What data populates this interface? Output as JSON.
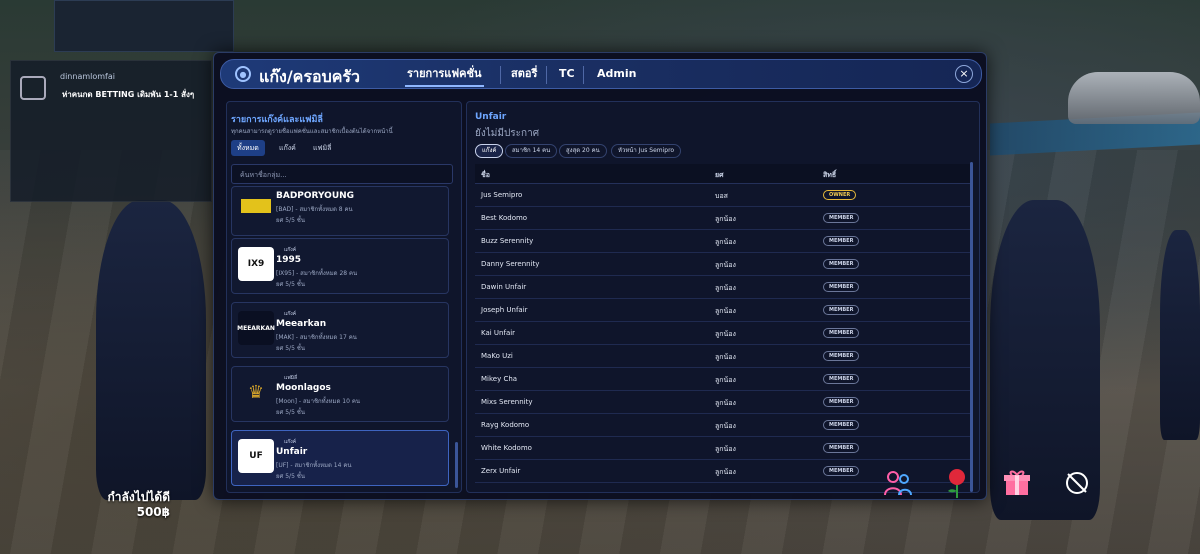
{
  "stream": {
    "username": "dinnamlomfai",
    "message": "ห่าคนกด BETTING เดิมพัน 1-1 สั่งๆ"
  },
  "hud": {
    "money_label": "กำลังไปได้ดี",
    "money_value": "500฿",
    "icons": [
      "friends-icon",
      "rose-icon",
      "gift-icon",
      "hide-icon"
    ]
  },
  "header": {
    "title": "แก๊ง/ครอบครัว",
    "tabs": [
      {
        "label": "รายการแฟคชั่น",
        "active": true
      },
      {
        "label": "สตอรี่",
        "active": false
      },
      {
        "label": "TC",
        "active": false
      },
      {
        "label": "Admin",
        "active": false
      }
    ],
    "close": "×"
  },
  "left": {
    "title": "รายการแก๊งค์และแฟมิลี่",
    "subtitle": "ทุกคนสามารถดูรายชื่อแฟคชั่นและสมาชิกเบื้องต้นได้จากหน้านี้",
    "filters": [
      {
        "label": "ทั้งหมด",
        "active": true
      },
      {
        "label": "แก๊งค์",
        "active": false
      },
      {
        "label": "แฟมิลี่",
        "active": false
      }
    ],
    "search_placeholder": "ค้นหาชื่อกลุ่ม...",
    "cards": [
      {
        "type": "",
        "name": "BADPORYOUNG",
        "desc": "[BAD] - สมาชิกทั้งหมด 8 คน",
        "rank": "ยศ 5/5 ชั้น",
        "logo": ""
      },
      {
        "type": "แก๊งค์",
        "name": "1995",
        "desc": "[IX95] - สมาชิกทั้งหมด 28 คน",
        "rank": "ยศ 5/5 ชั้น",
        "logo": "IX9"
      },
      {
        "type": "แก๊งค์",
        "name": "Meearkan",
        "desc": "[MAK] - สมาชิกทั้งหมด 17 คน",
        "rank": "ยศ 5/5 ชั้น",
        "logo": "MEEARKAN"
      },
      {
        "type": "แฟมิลี่",
        "name": "Moonlagos",
        "desc": "[Moon] - สมาชิกทั้งหมด 10 คน",
        "rank": "ยศ 5/5 ชั้น",
        "logo": "♛"
      },
      {
        "type": "แก๊งค์",
        "name": "Unfair",
        "desc": "[UF] - สมาชิกทั้งหมด 14 คน",
        "rank": "ยศ 5/5 ชั้น",
        "logo": "UF"
      }
    ]
  },
  "detail": {
    "name": "Unfair",
    "status": "ยังไม่มีประกาศ",
    "chips": [
      {
        "label": "แก๊งค์",
        "active": true
      },
      {
        "label": "สมาชิก 14 คน",
        "active": false
      },
      {
        "label": "สูงสุด 20 คน",
        "active": false
      },
      {
        "label": "หัวหน้า Jus Semipro",
        "active": false
      }
    ],
    "columns": [
      "ชื่อ",
      "ยศ",
      "สิทธิ์"
    ],
    "members": [
      {
        "name": "Jus Semipro",
        "rank": "บอส",
        "role": "OWNER"
      },
      {
        "name": "Best Kodomo",
        "rank": "ลูกน้อง",
        "role": "MEMBER"
      },
      {
        "name": "Buzz Serennity",
        "rank": "ลูกน้อง",
        "role": "MEMBER"
      },
      {
        "name": "Danny Serennity",
        "rank": "ลูกน้อง",
        "role": "MEMBER"
      },
      {
        "name": "Dawin Unfair",
        "rank": "ลูกน้อง",
        "role": "MEMBER"
      },
      {
        "name": "Joseph Unfair",
        "rank": "ลูกน้อง",
        "role": "MEMBER"
      },
      {
        "name": "Kai Unfair",
        "rank": "ลูกน้อง",
        "role": "MEMBER"
      },
      {
        "name": "MaKo Uzi",
        "rank": "ลูกน้อง",
        "role": "MEMBER"
      },
      {
        "name": "Mikey Cha",
        "rank": "ลูกน้อง",
        "role": "MEMBER"
      },
      {
        "name": "Mixs Serennity",
        "rank": "ลูกน้อง",
        "role": "MEMBER"
      },
      {
        "name": "Rayg Kodomo",
        "rank": "ลูกน้อง",
        "role": "MEMBER"
      },
      {
        "name": "White Kodomo",
        "rank": "ลูกน้อง",
        "role": "MEMBER"
      },
      {
        "name": "Zerx Unfair",
        "rank": "ลูกน้อง",
        "role": "MEMBER"
      }
    ]
  }
}
